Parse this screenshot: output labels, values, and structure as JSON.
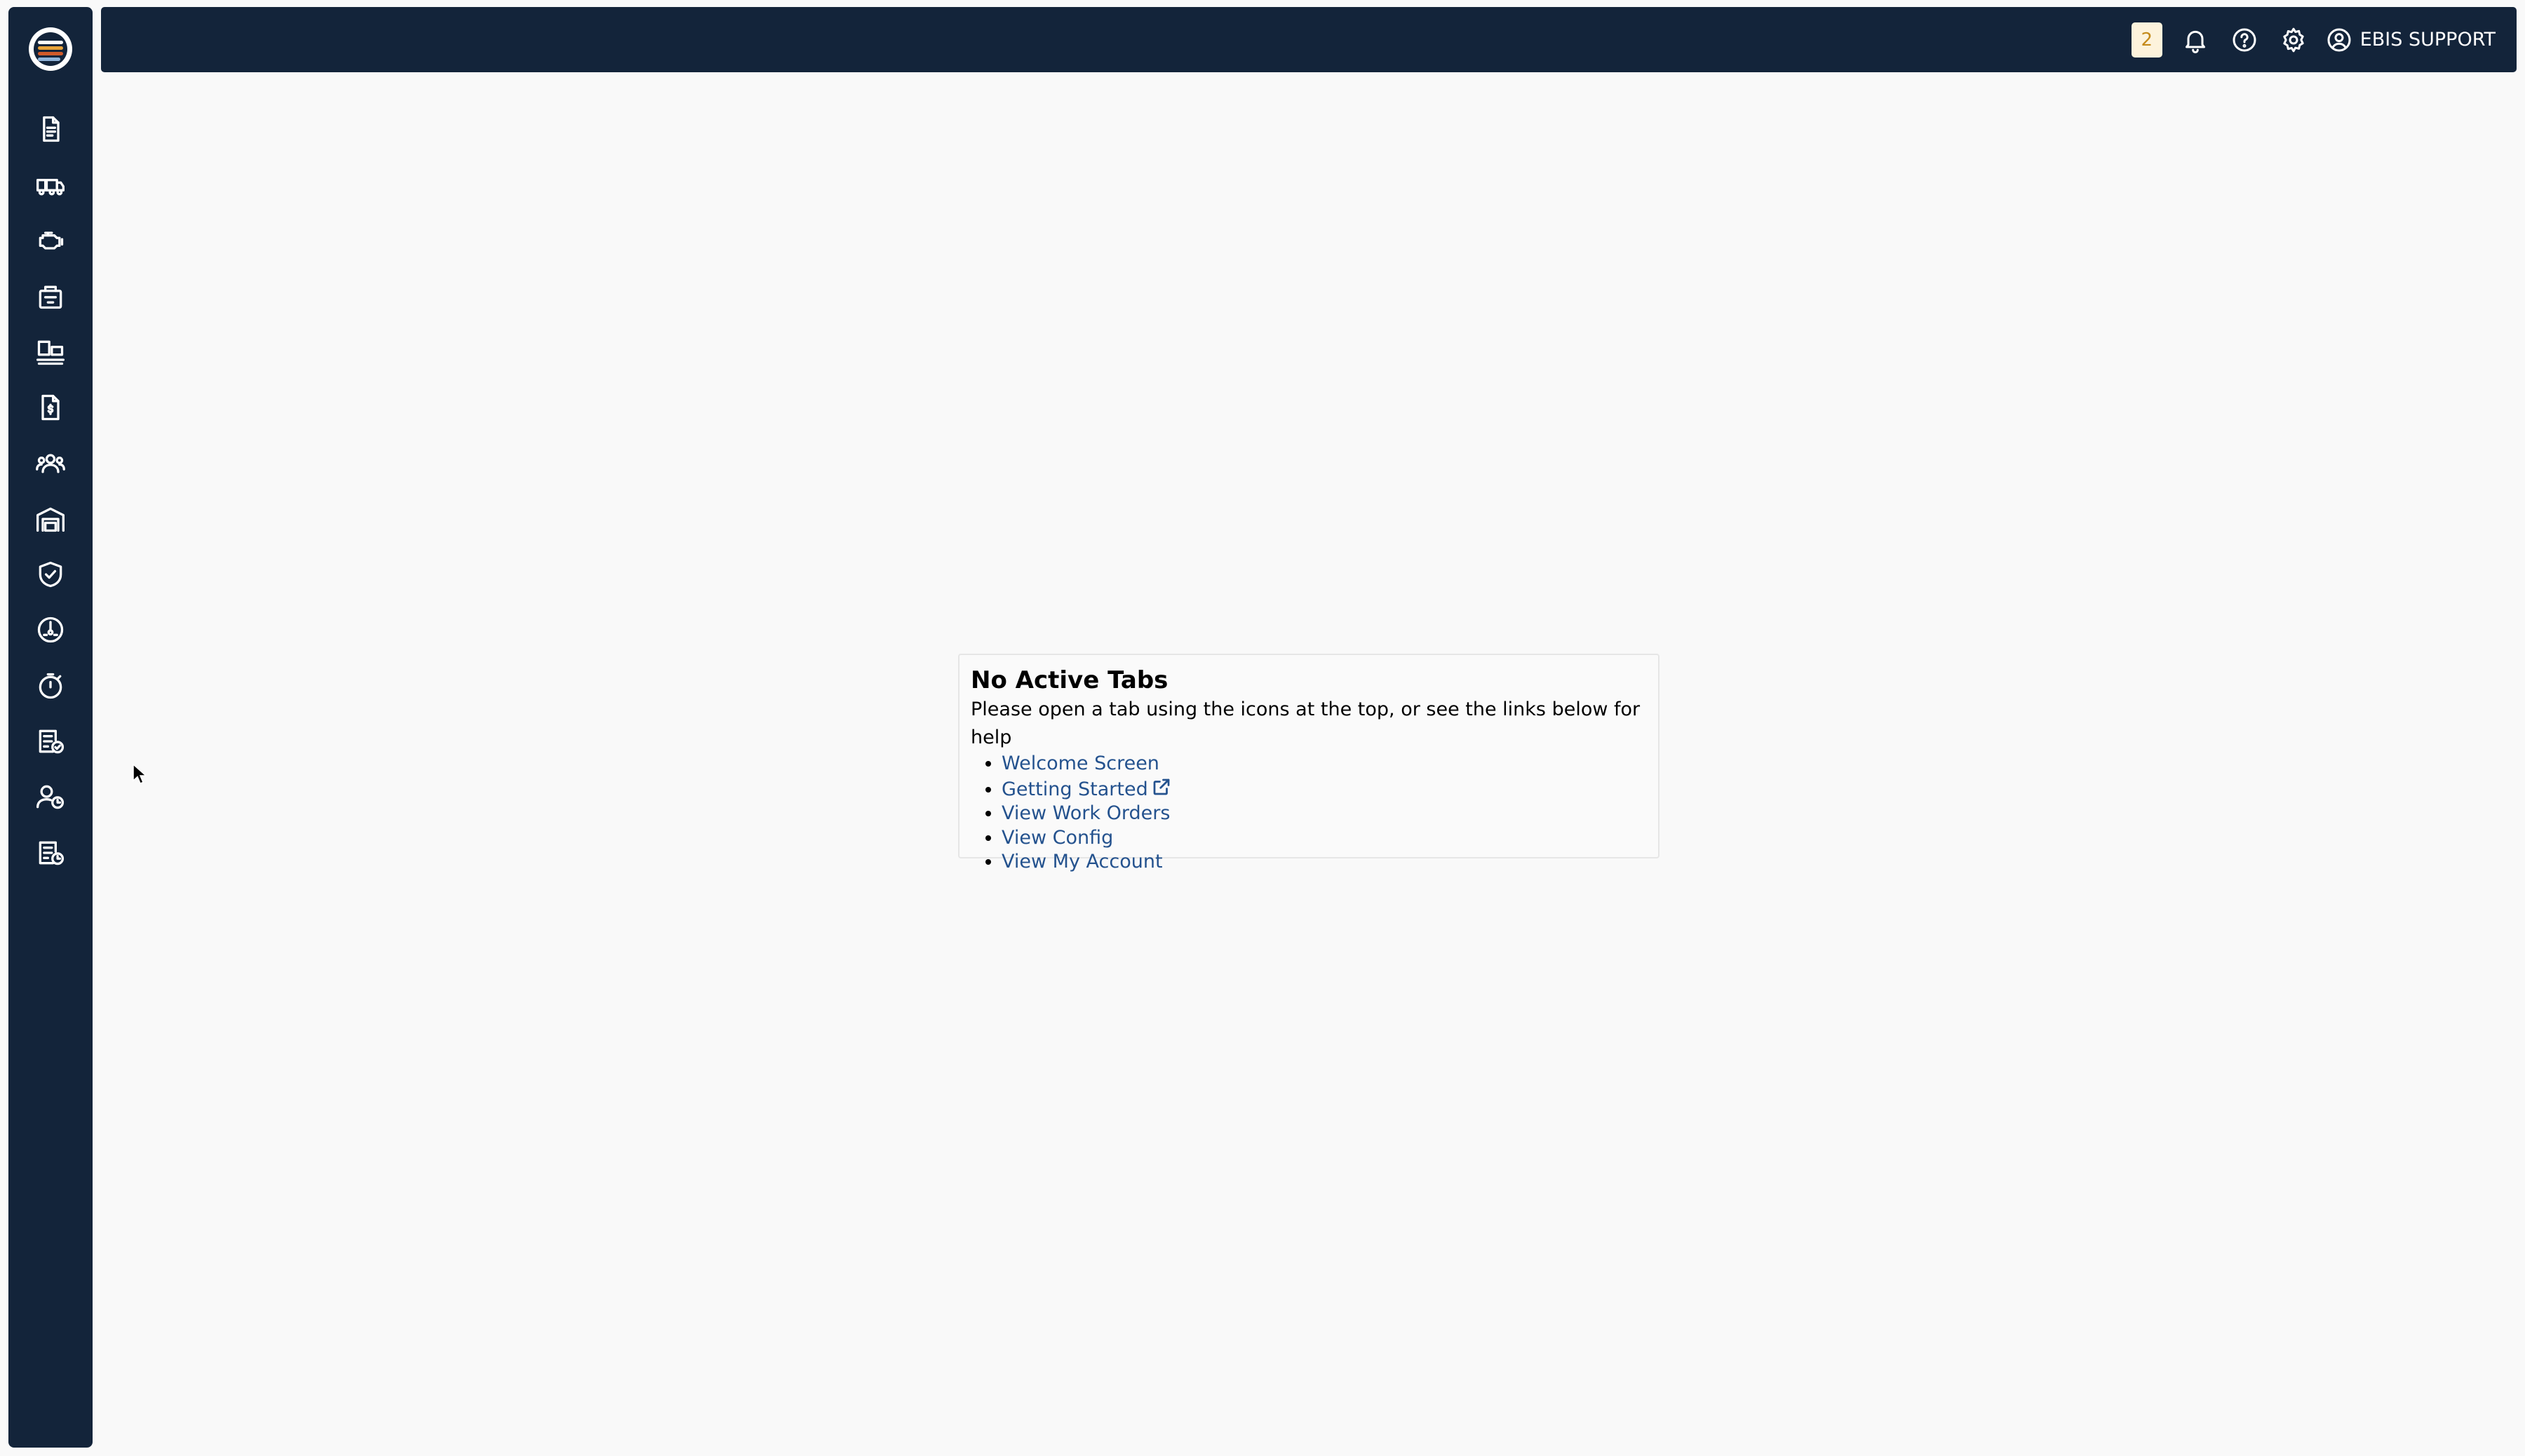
{
  "app": {
    "colors": {
      "chrome": "#13243a",
      "background": "#f9f9f9",
      "link": "#24528e",
      "badge_bg": "#fdf3dc",
      "badge_text": "#c48a1a"
    }
  },
  "sidebar": {
    "logo_icon": "app-logo",
    "items": [
      {
        "id": "documents",
        "icon": "document-icon"
      },
      {
        "id": "trucks",
        "icon": "truck-icon"
      },
      {
        "id": "engine",
        "icon": "engine-icon"
      },
      {
        "id": "parts",
        "icon": "parts-bag-icon"
      },
      {
        "id": "inventory",
        "icon": "inventory-icon"
      },
      {
        "id": "invoices",
        "icon": "invoice-icon"
      },
      {
        "id": "customers",
        "icon": "users-icon"
      },
      {
        "id": "facility",
        "icon": "garage-icon"
      },
      {
        "id": "warranty",
        "icon": "shield-check-icon"
      },
      {
        "id": "diagnostics",
        "icon": "gauge-icon"
      },
      {
        "id": "timer",
        "icon": "stopwatch-icon"
      },
      {
        "id": "approved-list",
        "icon": "list-check-icon"
      },
      {
        "id": "user-schedule",
        "icon": "user-clock-icon"
      },
      {
        "id": "list-schedule",
        "icon": "list-clock-icon"
      }
    ]
  },
  "topbar": {
    "notification_count": "2",
    "icons": [
      "bell-icon",
      "help-icon",
      "gear-icon",
      "user-circle-icon"
    ],
    "user_name": "EBIS SUPPORT"
  },
  "main": {
    "title": "No Active Tabs",
    "description": "Please open a tab using the icons at the top, or see the links below for help",
    "links": [
      {
        "label": "Welcome Screen",
        "external": false
      },
      {
        "label": "Getting Started",
        "external": true
      },
      {
        "label": "View Work Orders",
        "external": false
      },
      {
        "label": "View Config",
        "external": false
      },
      {
        "label": "View My Account",
        "external": false
      }
    ]
  }
}
